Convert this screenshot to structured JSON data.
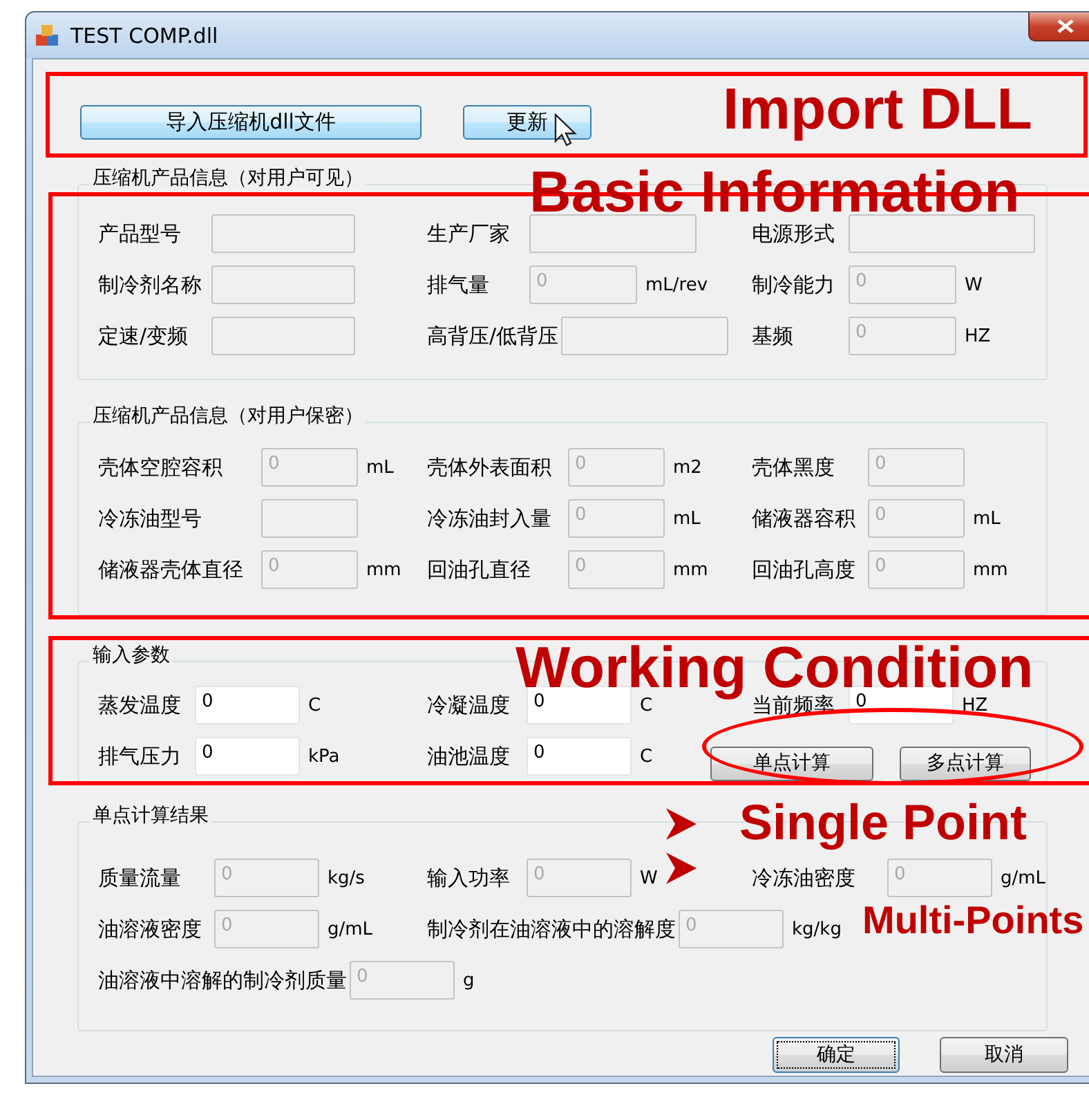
{
  "window": {
    "title": "TEST COMP.dll"
  },
  "toolbar": [
    {
      "label": "导入压缩机dll文件"
    },
    {
      "label": "更新"
    }
  ],
  "groups": [
    {
      "title": "压缩机产品信息（对用户可见）",
      "rows": [
        [
          {
            "kind": "field",
            "label": "产品型号",
            "disabled": true
          },
          {
            "kind": "field",
            "label": "生产厂家",
            "disabled": true
          },
          {
            "kind": "field",
            "label": "电源形式",
            "disabled": true
          }
        ],
        [
          {
            "kind": "field",
            "label": "制冷剂名称",
            "disabled": true
          },
          {
            "kind": "field",
            "label": "排气量",
            "value": "0",
            "unit": "mL/rev",
            "disabled": true
          },
          {
            "kind": "field",
            "label": "制冷能力",
            "value": "0",
            "unit": "W",
            "disabled": true
          }
        ],
        [
          {
            "kind": "field",
            "label": "定速/变频",
            "disabled": true
          },
          {
            "kind": "field",
            "label": "高背压/低背压",
            "disabled": true
          },
          {
            "kind": "field",
            "label": "基频",
            "value": "0",
            "unit": "HZ",
            "disabled": true
          }
        ]
      ]
    },
    {
      "title": "压缩机产品信息（对用户保密）",
      "rows": [
        [
          {
            "kind": "field",
            "label": "壳体空腔容积",
            "value": "0",
            "unit": "mL",
            "disabled": true
          },
          {
            "kind": "field",
            "label": "壳体外表面积",
            "value": "0",
            "unit": "m2",
            "disabled": true
          },
          {
            "kind": "field",
            "label": "壳体黑度",
            "value": "0",
            "disabled": true
          }
        ],
        [
          {
            "kind": "field",
            "label": "冷冻油型号",
            "disabled": true
          },
          {
            "kind": "field",
            "label": "冷冻油封入量",
            "value": "0",
            "unit": "mL",
            "disabled": true
          },
          {
            "kind": "field",
            "label": "储液器容积",
            "value": "0",
            "unit": "mL",
            "disabled": true
          }
        ],
        [
          {
            "kind": "field",
            "label": "储液器壳体直径",
            "value": "0",
            "unit": "mm",
            "disabled": true
          },
          {
            "kind": "field",
            "label": "回油孔直径",
            "value": "0",
            "unit": "mm",
            "disabled": true
          },
          {
            "kind": "field",
            "label": "回油孔高度",
            "value": "0",
            "unit": "mm",
            "disabled": true
          }
        ]
      ]
    },
    {
      "title": "输入参数",
      "rows": [
        [
          {
            "kind": "field",
            "label": "蒸发温度",
            "value": "0",
            "unit": "C",
            "disabled": false
          },
          {
            "kind": "field",
            "label": "冷凝温度",
            "value": "0",
            "unit": "C",
            "disabled": false
          },
          {
            "kind": "field",
            "label": "当前频率",
            "value": "0",
            "unit": "HZ",
            "disabled": false
          }
        ],
        [
          {
            "kind": "field",
            "label": "排气压力",
            "value": "0",
            "unit": "kPa",
            "disabled": false
          },
          {
            "kind": "field",
            "label": "油池温度",
            "value": "0",
            "unit": "C",
            "disabled": false
          },
          {
            "kind": "buttons",
            "buttons": [
              "单点计算",
              "多点计算"
            ]
          }
        ]
      ]
    },
    {
      "title": "单点计算结果",
      "rows": [
        [
          {
            "kind": "field",
            "label": "质量流量",
            "value": "0",
            "unit": "kg/s",
            "disabled": true
          },
          {
            "kind": "field",
            "label": "输入功率",
            "value": "0",
            "unit": "W",
            "disabled": true
          },
          {
            "kind": "field",
            "label": "冷冻油密度",
            "value": "0",
            "unit": "g/mL",
            "disabled": true
          }
        ],
        [
          {
            "kind": "field",
            "label": "油溶液密度",
            "value": "0",
            "unit": "g/mL",
            "disabled": true
          },
          {
            "kind": "field",
            "label": "制冷剂在油溶液中的溶解度",
            "value": "0",
            "unit": "kg/kg",
            "disabled": true
          }
        ],
        [
          {
            "kind": "field",
            "label": "油溶液中溶解的制冷剂质量",
            "value": "0",
            "unit": "g",
            "disabled": true
          }
        ]
      ]
    }
  ],
  "footer_buttons": [
    {
      "label": "确定",
      "focused": true
    },
    {
      "label": "取消",
      "focused": false
    }
  ],
  "annotations": [
    {
      "kind": "box"
    },
    {
      "kind": "text",
      "text": "Import DLL"
    },
    {
      "kind": "box"
    },
    {
      "kind": "text",
      "text": "Basic Information"
    },
    {
      "kind": "box"
    },
    {
      "kind": "text",
      "text": "Working Condition"
    },
    {
      "kind": "ellipse"
    },
    {
      "kind": "arrow"
    },
    {
      "kind": "arrow"
    },
    {
      "kind": "text",
      "text": "Single Point"
    },
    {
      "kind": "text",
      "text": "Multi-Points"
    }
  ]
}
